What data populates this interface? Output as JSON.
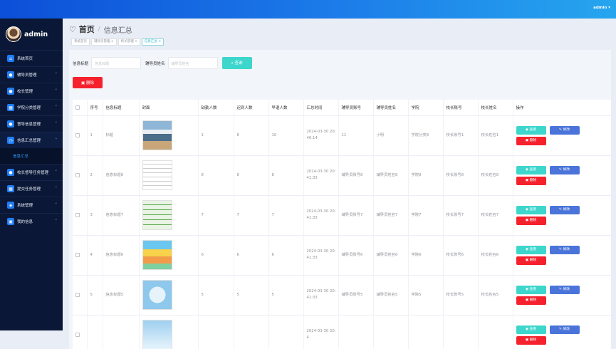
{
  "topbar": {
    "user": "admin ▾"
  },
  "sidebar": {
    "username": "admin",
    "items": [
      {
        "label": "系统首页",
        "icon": "home-icon",
        "chev": ""
      },
      {
        "label": "辅导员管理",
        "icon": "user-icon",
        "chev": "˅"
      },
      {
        "label": "校长管理",
        "icon": "user-icon",
        "chev": "˅"
      },
      {
        "label": "学院分类管理",
        "icon": "grid-icon",
        "chev": "˅"
      },
      {
        "label": "督导信息管理",
        "icon": "user-icon",
        "chev": "˅"
      },
      {
        "label": "信息汇总管理",
        "icon": "chart-icon",
        "chev": "˄"
      },
      {
        "label": "校长督导任务管理",
        "icon": "task-icon",
        "chev": "˅"
      },
      {
        "label": "提交任务管理",
        "icon": "grid-icon",
        "chev": "˅"
      },
      {
        "label": "系统管理",
        "icon": "shield-icon",
        "chev": "˅"
      },
      {
        "label": "我的信息",
        "icon": "profile-icon",
        "chev": "˅"
      }
    ],
    "submenu": "信息汇总"
  },
  "header": {
    "home": "首页",
    "sep": "/",
    "current": "信息汇总"
  },
  "tags": [
    "系统首页",
    "辅导员管理 ×",
    "校长管理 ×",
    "信息汇总 ×"
  ],
  "search": {
    "label1": "信息标题",
    "placeholder1": "信息标题",
    "label2": "辅导员姓名",
    "placeholder2": "辅导员姓名",
    "button": "⌕ 查询"
  },
  "delete_button": "▣ 删除",
  "table": {
    "headers": [
      "序号",
      "信息标题",
      "封面",
      "缺勤人数",
      "迟到人数",
      "早退人数",
      "汇总时间",
      "辅导员账号",
      "辅导员姓名",
      "学院",
      "校长账号",
      "校长姓名",
      "操作"
    ],
    "ops": {
      "view": "◉ 查看",
      "edit": "✎ 修改",
      "del": "▣ 删除"
    },
    "rows": [
      {
        "no": "1",
        "title": "标题",
        "absent": "1",
        "late": "8",
        "early": "10",
        "time": "2024-03-30 20:46:14",
        "acct": "11",
        "name": "小明",
        "college": "学院分类8",
        "pacct": "校长账号1",
        "pname": "校长姓名1",
        "thumb": "classroom"
      },
      {
        "no": "2",
        "title": "信息标题8",
        "absent": "8",
        "late": "8",
        "early": "8",
        "time": "2024-03-30 20:41:33",
        "acct": "辅导员账号8",
        "name": "辅导员姓名8",
        "college": "学院8",
        "pacct": "校长账号8",
        "pname": "校长姓名8",
        "thumb": "schedule"
      },
      {
        "no": "3",
        "title": "信息标题7",
        "absent": "7",
        "late": "7",
        "early": "7",
        "time": "2024-03-30 20:41:33",
        "acct": "辅导员账号7",
        "name": "辅导员姓名7",
        "college": "学院7",
        "pacct": "校长账号7",
        "pname": "校长姓名7",
        "thumb": "green"
      },
      {
        "no": "4",
        "title": "信息标题6",
        "absent": "6",
        "late": "6",
        "early": "6",
        "time": "2024-03-30 20:41:33",
        "acct": "辅导员账号6",
        "name": "辅导员姓名6",
        "college": "学院6",
        "pacct": "校长账号6",
        "pname": "校长姓名6",
        "thumb": "colorful"
      },
      {
        "no": "5",
        "title": "信息标题5",
        "absent": "5",
        "late": "5",
        "early": "5",
        "time": "2024-03-30 20:41:33",
        "acct": "辅导员账号5",
        "name": "辅导员姓名5",
        "college": "学院5",
        "pacct": "校长账号5",
        "pname": "校长姓名5",
        "thumb": "bluecal"
      },
      {
        "no": "",
        "title": "",
        "absent": "",
        "late": "",
        "early": "",
        "time": "2024-03-30 20:4",
        "acct": "",
        "name": "",
        "college": "",
        "pacct": "",
        "pname": "",
        "thumb": "bluecal2"
      }
    ]
  }
}
